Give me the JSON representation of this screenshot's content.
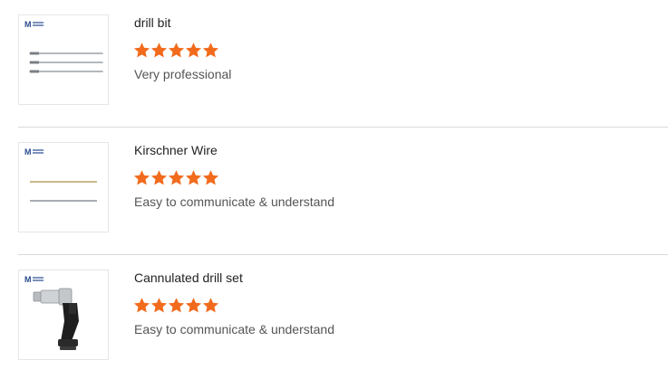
{
  "reviews": [
    {
      "title": "drill bit",
      "rating": 5,
      "comment": "Very professional",
      "thumbnail": "drill-bit-icon"
    },
    {
      "title": "Kirschner Wire",
      "rating": 5,
      "comment": "Easy to communicate & understand",
      "thumbnail": "kirschner-wire-icon"
    },
    {
      "title": "Cannulated drill set",
      "rating": 5,
      "comment": "Easy to communicate & understand",
      "thumbnail": "cannulated-drill-icon"
    }
  ],
  "colors": {
    "star": "#f26b1d",
    "divider": "#d9d9d9",
    "logo": "#2a4b8d"
  },
  "icons": {
    "star": "star-icon",
    "logo": "brand-logo-icon"
  }
}
